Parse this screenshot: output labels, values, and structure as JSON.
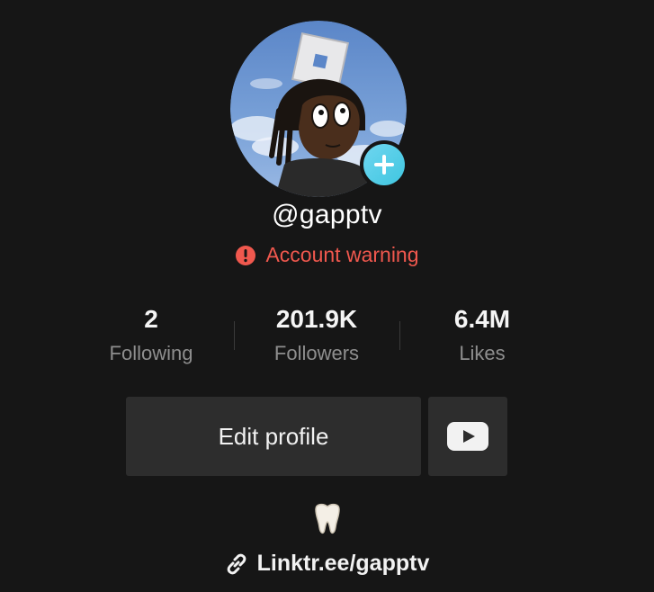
{
  "profile": {
    "username": "@gapptv",
    "warning_text": "Account warning",
    "warning_color": "#f0584e",
    "accent_color": "#3fc6e0"
  },
  "stats": [
    {
      "value": "2",
      "label": "Following"
    },
    {
      "value": "201.9K",
      "label": "Followers"
    },
    {
      "value": "6.4M",
      "label": "Likes"
    }
  ],
  "actions": {
    "edit_label": "Edit profile",
    "youtube_icon": "youtube-icon"
  },
  "bio": {
    "emoji_icon": "tooth-icon",
    "link_text": "Linktr.ee/gapptv",
    "link_icon": "link-icon"
  }
}
